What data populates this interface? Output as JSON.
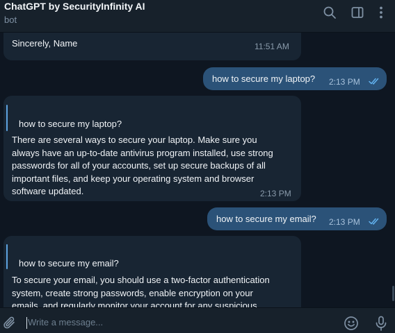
{
  "header": {
    "title": "ChatGPT by SecurityInfinity AI",
    "subtitle": "bot",
    "icons": [
      "search-icon",
      "sidebar-toggle-icon",
      "more-vertical-icon"
    ]
  },
  "messages": {
    "m1": {
      "text": "Sincerely,  Name",
      "time": "11:51 AM"
    },
    "m2": {
      "text": "how to secure my laptop?",
      "time": "2:13 PM",
      "status": "read"
    },
    "m3": {
      "quote": "how to secure my laptop?",
      "lines": [
        "There are several ways to secure your laptop. Make sure you",
        "always have an up-to-date antivirus program installed, use strong",
        "passwords for all of your accounts, set up secure backups of all",
        "important files, and keep your operating system and browser",
        "software updated."
      ],
      "time": "2:13 PM"
    },
    "m4": {
      "text": "how to secure my email?",
      "time": "2:13 PM",
      "status": "read"
    },
    "m5": {
      "quote": "how to secure my email?",
      "lines": [
        "To secure your email, you should use a two-factor authentication",
        "system, create strong passwords, enable encryption on your",
        "emails, and regularly monitor your account for any suspicious"
      ]
    }
  },
  "composer": {
    "placeholder": "Write a message...",
    "value": "",
    "icons": [
      "paperclip-icon",
      "emoji-icon",
      "microphone-icon"
    ]
  },
  "colors": {
    "background": "#0e1621",
    "panel": "#17212b",
    "incoming_bubble": "#182533",
    "outgoing_bubble": "#2b5278",
    "accent": "#5ea3e0",
    "read_ticks": "#62b2ef"
  }
}
